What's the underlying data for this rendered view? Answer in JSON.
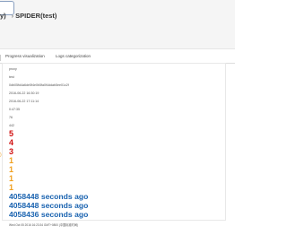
{
  "header": {
    "crumb_prefix": "y)",
    "title": "SPIDER(test)"
  },
  "tabs": [
    {
      "label": "Progress visualization"
    },
    {
      "label": "Logs categorization"
    }
  ],
  "details": {
    "project": "proxy",
    "name": "test",
    "task_id": "0db05fd4a6de5f4e0b5fa0f4ddab5ee01c2f",
    "start_time": "2016-06-22 16:30:19",
    "end_time": "2016-06-22 17:11:14",
    "duration": "0:47:35",
    "item_count": "76",
    "status": "442",
    "error_count": "5",
    "warning_count": "4",
    "critical_count": "3",
    "info1": "1",
    "info2": "1",
    "info3": "1",
    "info4": "1",
    "ago1": "4058448 seconds ago",
    "ago2": "4058448 seconds ago",
    "ago3": "4058436 seconds ago",
    "footer": "Wed Oct 05 2016 16:23:34 GMT+0800 (中国标准时间)"
  },
  "left_marker": ")",
  "colors": {
    "error": "#d01010",
    "warning": "#f0a020",
    "link": "#1a63b0"
  }
}
